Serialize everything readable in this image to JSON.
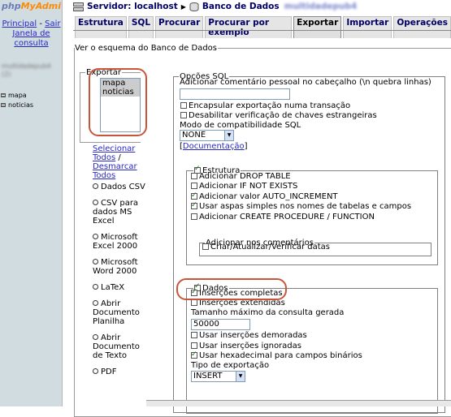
{
  "sidebar": {
    "logo_part1": "php",
    "logo_part2": "MyAdmi",
    "link_principal": "Principal",
    "link_separator": " - ",
    "link_sair": "Sair",
    "link_janela_line1": "Janela de",
    "link_janela_line2": "consulta",
    "db_name": "multidadepub4",
    "db_count": "(2)",
    "tables": [
      "mapa",
      "noticias"
    ]
  },
  "header": {
    "breadcrumb_server": "Servidor: localhost",
    "breadcrumb_database": "Banco de Dados",
    "database_name": "multidadepub4"
  },
  "tabs": [
    "Estrutura",
    "SQL",
    "Procurar",
    "Procurar por exemplo",
    "Exportar",
    "Importar",
    "Operações"
  ],
  "outer_legend": "Ver o esquema do Banco de Dados",
  "exportar": {
    "legend": "Exportar",
    "tables": [
      "mapa",
      "noticias"
    ],
    "select_all": "Selecionar Todos",
    "select_sep": " /",
    "deselect_all": "Desmarcar Todos",
    "formats": [
      "Dados CSV",
      "CSV para dados MS Excel",
      "Microsoft Excel 2000",
      "Microsoft Word 2000",
      "LaTeX",
      "Abrir Documento Planilha",
      "Abrir Documento de Texto",
      "PDF"
    ]
  },
  "sql_options": {
    "legend": "Opções SQL",
    "comment_label": "Adicionar comentário pessoal no cabeçalho (\\n quebra linhas)",
    "comment_value": "",
    "encapsular": "Encapsular exportação numa transação",
    "desabilitar": "Desabilitar verificação de chaves estrangeiras",
    "compat_label": "Modo de compatibilidade SQL",
    "compat_value": "NONE",
    "doc_open": "[",
    "doc_link": "Documentação",
    "doc_close": "]"
  },
  "estrutura": {
    "legend": "Estrutura",
    "options": [
      {
        "label": "Adicionar DROP TABLE",
        "checked": false
      },
      {
        "label": "Adicionar IF NOT EXISTS",
        "checked": false
      },
      {
        "label": "Adicionar valor AUTO_INCREMENT",
        "checked": true
      },
      {
        "label": "Usar aspas simples nos nomes de tabelas e campos",
        "checked": true
      },
      {
        "label": "Adicionar CREATE PROCEDURE / FUNCTION",
        "checked": false
      }
    ],
    "comments_legend": "Adicionar nos comentários",
    "comments_option": "Criar/Atualizar/Verificar datas"
  },
  "dados": {
    "legend": "Dados",
    "insercoes_completas": "Inserções completas",
    "insercoes_estendidas": "Inserções extendidas",
    "max_label": "Tamanho máximo da consulta gerada",
    "max_value": "50000",
    "demoradas": "Usar inserções demoradas",
    "ignoradas": "Usar inserções ignoradas",
    "hexadecimal": "Usar hexadecimal para campos binários",
    "tipo_label": "Tipo de exportação",
    "tipo_value": "INSERT"
  },
  "colors": {
    "sidebar_bg": "#d0dce0",
    "link": "#2828c8",
    "annotation": "#c8553a",
    "logo_blue": "#6c7dbb",
    "logo_orange": "#ff8a00"
  }
}
